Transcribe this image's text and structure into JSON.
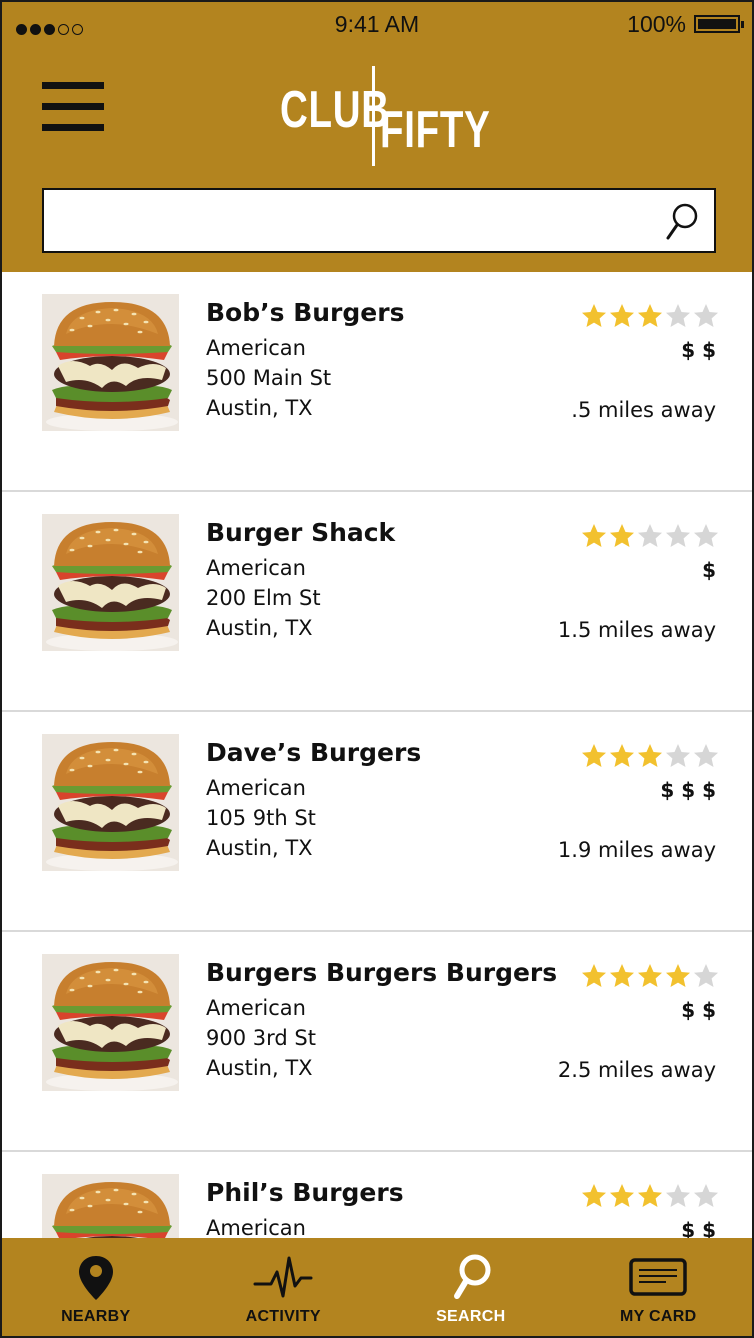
{
  "status_bar": {
    "time": "9:41 AM",
    "battery": "100%"
  },
  "header": {
    "logo_left": "CLUB",
    "logo_right": "FIFTY",
    "search_placeholder": ""
  },
  "restaurants": [
    {
      "name": "Bob’s Burgers",
      "cuisine": "American",
      "address": "500 Main St",
      "city": "Austin, TX",
      "rating": 3,
      "price": "$ $",
      "distance": ".5 miles away"
    },
    {
      "name": "Burger Shack",
      "cuisine": "American",
      "address": "200 Elm St",
      "city": "Austin, TX",
      "rating": 2,
      "price": "$",
      "distance": "1.5 miles away"
    },
    {
      "name": "Dave’s Burgers",
      "cuisine": "American",
      "address": "105 9th St",
      "city": "Austin, TX",
      "rating": 3,
      "price": "$ $ $",
      "distance": "1.9 miles away"
    },
    {
      "name": "Burgers Burgers Burgers",
      "cuisine": "American",
      "address": "900 3rd St",
      "city": "Austin, TX",
      "rating": 4,
      "price": "$ $",
      "distance": "2.5 miles away"
    },
    {
      "name": "Phil’s Burgers",
      "cuisine": "American",
      "address": "",
      "city": "",
      "rating": 3,
      "price": "$ $",
      "distance": ""
    }
  ],
  "rating_max": 5,
  "nav": [
    {
      "label": "NEARBY",
      "icon": "map-pin-icon",
      "active": false
    },
    {
      "label": "ACTIVITY",
      "icon": "pulse-icon",
      "active": false
    },
    {
      "label": "SEARCH",
      "icon": "search-icon",
      "active": true
    },
    {
      "label": "MY CARD",
      "icon": "card-icon",
      "active": false
    }
  ],
  "colors": {
    "brand": "#b3841f",
    "star_on": "#f2c12e",
    "star_off": "#d6d6d6"
  }
}
